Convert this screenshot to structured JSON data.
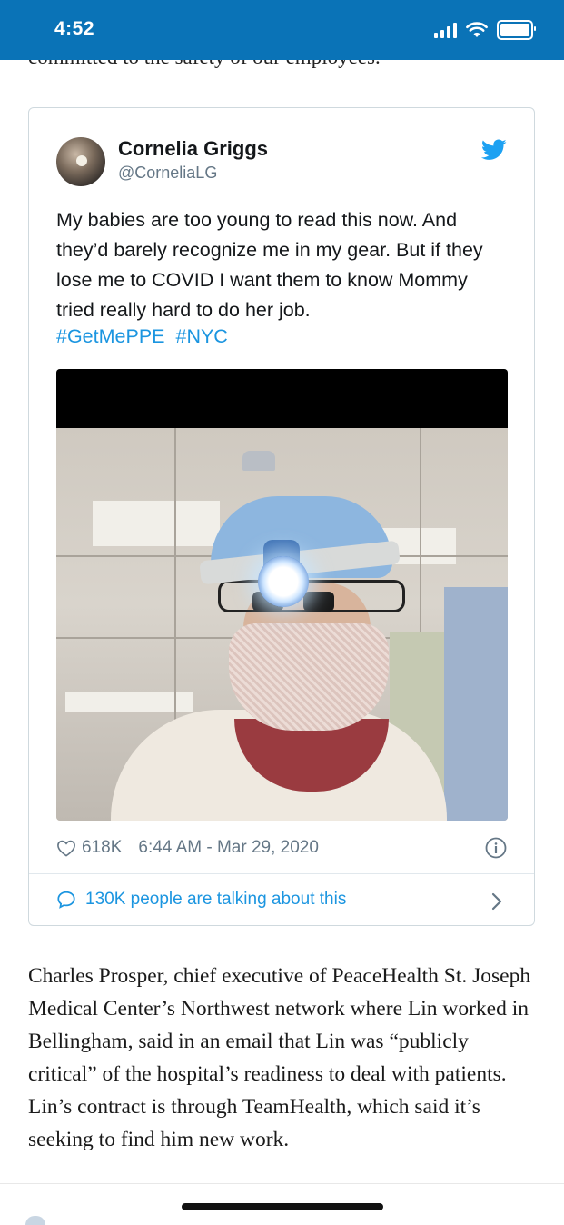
{
  "status_bar": {
    "time": "4:52"
  },
  "article_above": {
    "cut_line": "committed to the safety of our employees."
  },
  "tweet": {
    "author_name": "Cornelia Griggs",
    "author_handle": "@CorneliaLG",
    "text": "My babies are too young to read this now. And they’d barely recognize me in my gear. But if they lose me to COVID I want them to know Mommy tried really hard to do her job.",
    "hashtags": [
      "#GetMePPE",
      "#NYC"
    ],
    "likes": "618K",
    "timestamp": "6:44 AM - Mar 29, 2020",
    "talking": "130K people are talking about this",
    "colors": {
      "link": "#1b95e0",
      "meta": "#657786",
      "border": "#cfd9de"
    },
    "icons": [
      "twitter-bird-icon",
      "heart-icon",
      "info-icon",
      "speech-bubble-icon",
      "chevron-right-icon"
    ]
  },
  "article": {
    "paragraph": "Charles Prosper, chief executive of PeaceHealth St. Joseph Medical Center’s Northwest network where Lin worked in Bellingham, said in an email that Lin was “publicly critical” of the hospital’s readiness to deal with patients. Lin’s contract is through TeamHealth, which said it’s seeking to find him new work."
  },
  "theme": {
    "status_bar_color": "#0a73b7"
  }
}
